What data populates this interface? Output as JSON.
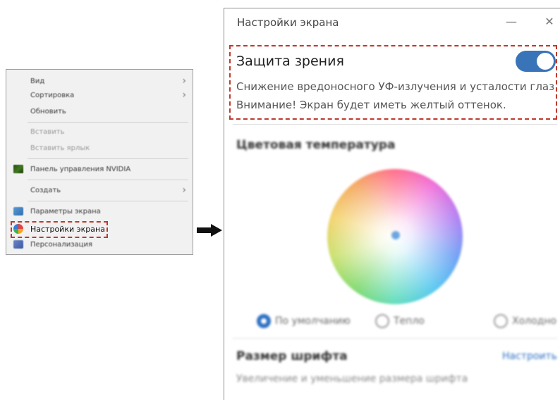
{
  "context_menu": {
    "items": [
      {
        "label": "Вид",
        "has_submenu": true
      },
      {
        "label": "Сортировка",
        "has_submenu": true
      },
      {
        "label": "Обновить"
      },
      {
        "label": "Вставить",
        "disabled": true
      },
      {
        "label": "Вставить ярлык",
        "disabled": true
      },
      {
        "label": "Панель управления NVIDIA",
        "icon": "nvidia-icon"
      },
      {
        "label": "Создать",
        "has_submenu": true
      },
      {
        "label": "Параметры экрана",
        "icon": "monitor-icon"
      },
      {
        "label": "Настройки экрана",
        "icon": "palette-icon",
        "highlighted": true
      },
      {
        "label": "Персонализация",
        "icon": "personalize-icon"
      }
    ],
    "submenu_glyph": "›"
  },
  "window": {
    "title": "Настройки экрана",
    "minimize_glyph": "—",
    "close_glyph": "✕"
  },
  "eye_protection": {
    "title": "Защита зрения",
    "description_line1": "Снижение вредоносного УФ-излучения и усталости глаз",
    "description_line2": "Внимание! Экран будет иметь желтый оттенок.",
    "enabled": true,
    "accent_color": "#3a74b8"
  },
  "color_temperature": {
    "title": "Цветовая температура",
    "options": [
      {
        "label": "По умолчанию",
        "selected": true
      },
      {
        "label": "Тепло",
        "selected": false
      },
      {
        "label": "Холодно",
        "selected": false
      }
    ]
  },
  "font_size": {
    "title": "Размер шрифта",
    "link_label": "Настроить",
    "description": "Увеличение и уменьшение размера шрифта"
  },
  "colors": {
    "highlight": "#c0392b",
    "link": "#2d70c2"
  }
}
